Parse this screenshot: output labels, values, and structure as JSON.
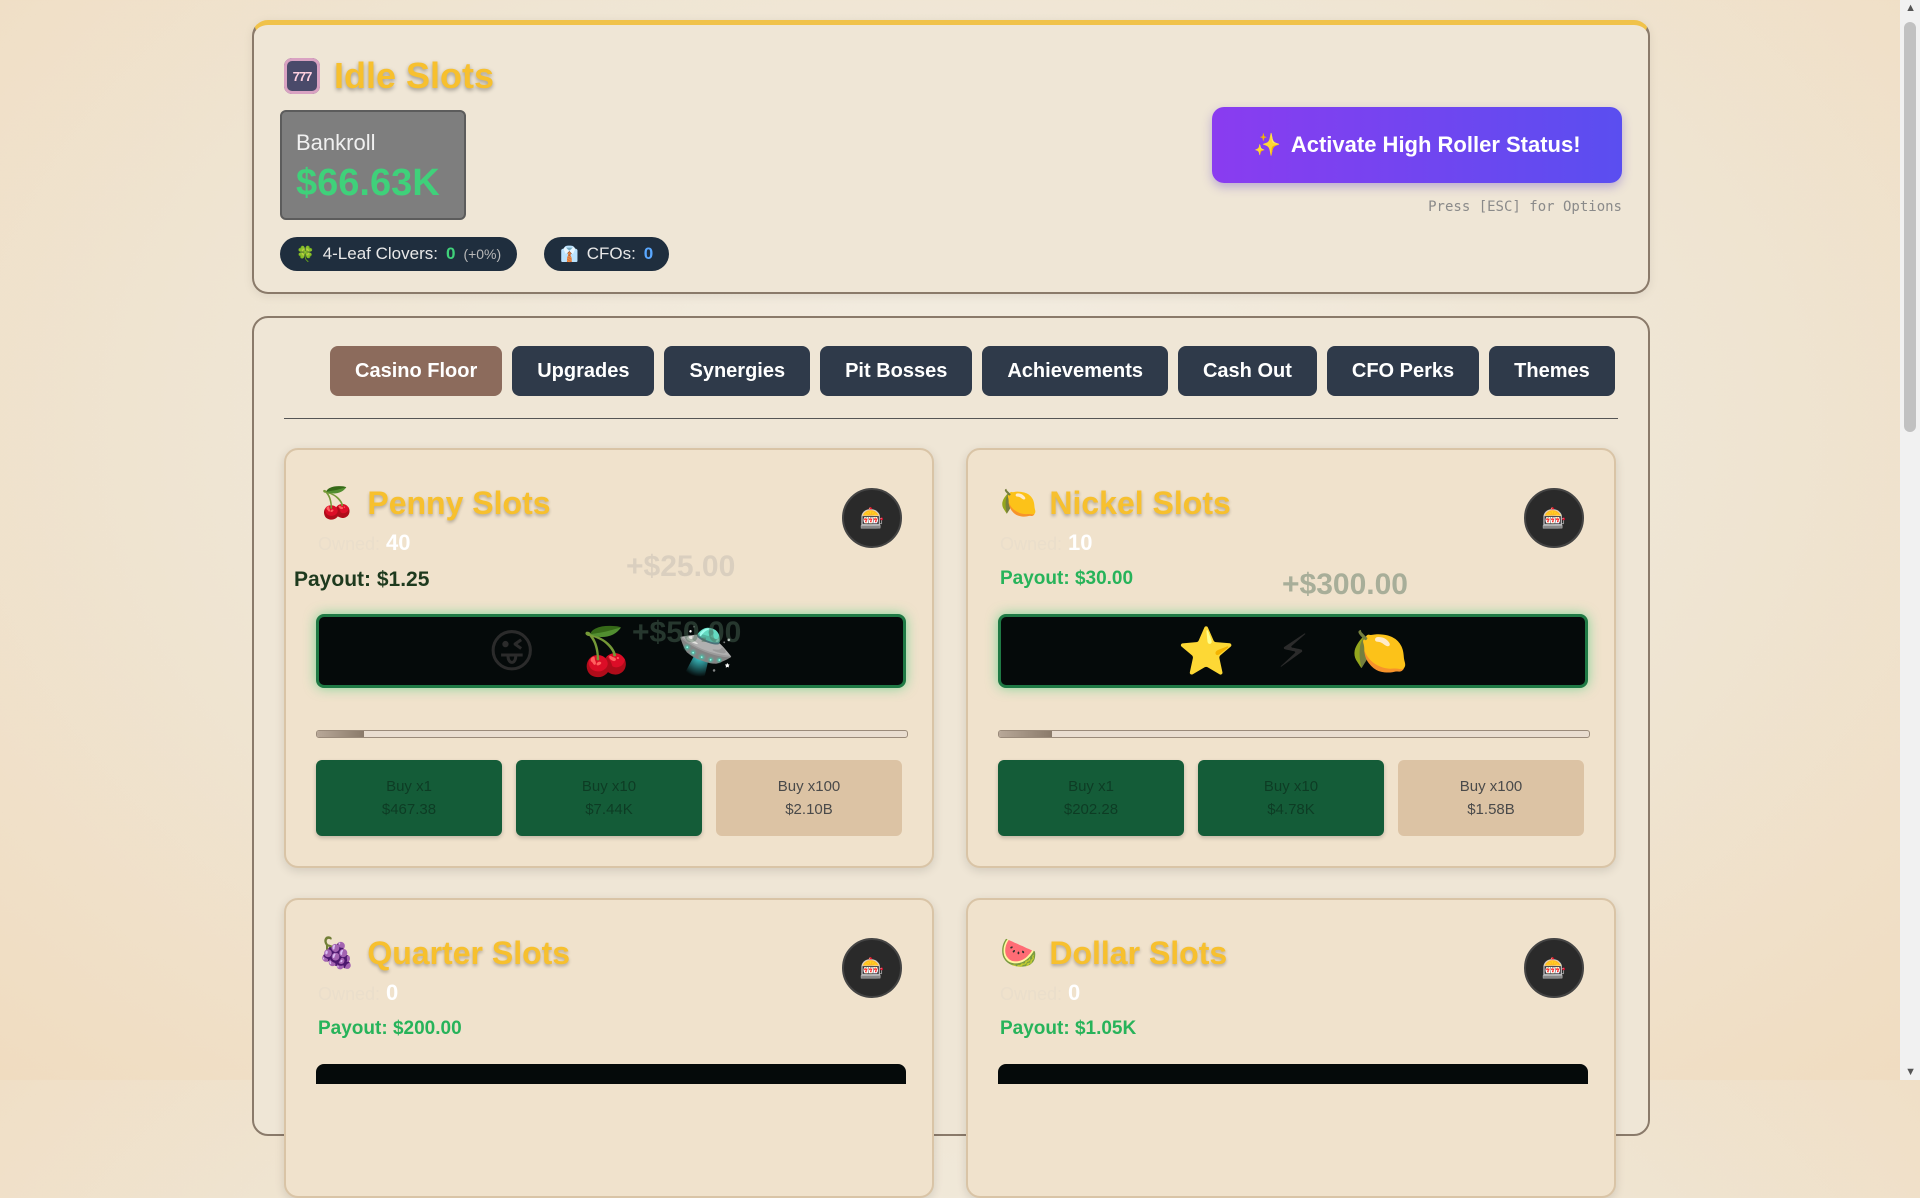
{
  "header": {
    "title": "Idle Slots",
    "title_icon": "slot-machine-icon",
    "title_icon_glyph": "777",
    "bankroll_label": "Bankroll",
    "bankroll_value": "$66.63K",
    "clovers_label": "4-Leaf Clovers:",
    "clovers_value": "0",
    "clovers_bonus": "(+0%)",
    "clovers_icon_glyph": "🍀",
    "cfos_label": "CFOs:",
    "cfos_value": "0",
    "cfos_icon_glyph": "👔",
    "high_roller_label": "Activate High Roller Status!",
    "high_roller_glyph": "✨",
    "esc_hint": "Press [ESC] for Options"
  },
  "tabs": [
    {
      "label": "Casino Floor",
      "active": true
    },
    {
      "label": "Upgrades"
    },
    {
      "label": "Synergies"
    },
    {
      "label": "Pit Bosses"
    },
    {
      "label": "Achievements"
    },
    {
      "label": "Cash Out"
    },
    {
      "label": "CFO Perks"
    },
    {
      "label": "Themes"
    }
  ],
  "machines": [
    {
      "name": "Penny Slots",
      "emoji": "🍒",
      "owned_label": "Owned:",
      "owned": "40",
      "payout": "Payout: $1.25",
      "reels": [
        "😜",
        "🍒",
        "🛸"
      ],
      "float_win_back": "+$25.00",
      "float_win": "+$50.00",
      "progress": 0.08,
      "buy": [
        {
          "label": "Buy x1",
          "cost": "$467.38"
        },
        {
          "label": "Buy x10",
          "cost": "$7.44K"
        },
        {
          "label": "Buy x100",
          "cost": "$2.10B"
        }
      ]
    },
    {
      "name": "Nickel Slots",
      "emoji": "🍋",
      "owned_label": "Owned:",
      "owned": "10",
      "payout": "Payout: $30.00",
      "reels": [
        "⭐",
        "⚡",
        "🍋"
      ],
      "float_win": "+$300.00",
      "progress": 0.09,
      "buy": [
        {
          "label": "Buy x1",
          "cost": "$202.28"
        },
        {
          "label": "Buy x10",
          "cost": "$4.78K"
        },
        {
          "label": "Buy x100",
          "cost": "$1.58B"
        }
      ]
    },
    {
      "name": "Quarter Slots",
      "emoji": "🍇",
      "owned_label": "Owned:",
      "owned": "0",
      "payout": "Payout: $200.00"
    },
    {
      "name": "Dollar Slots",
      "emoji": "🍉",
      "owned_label": "Owned:",
      "owned": "0",
      "payout": "Payout: $1.05K"
    }
  ],
  "autospin_glyph": "🎰",
  "colors": {
    "accent_gold": "#f7c02e",
    "money_green": "#3fd17a",
    "tab_dark": "#2f3a4a",
    "tab_active": "#8c6b5c",
    "high_roller_start": "#8a3cf0",
    "high_roller_end": "#5a4ef0"
  }
}
